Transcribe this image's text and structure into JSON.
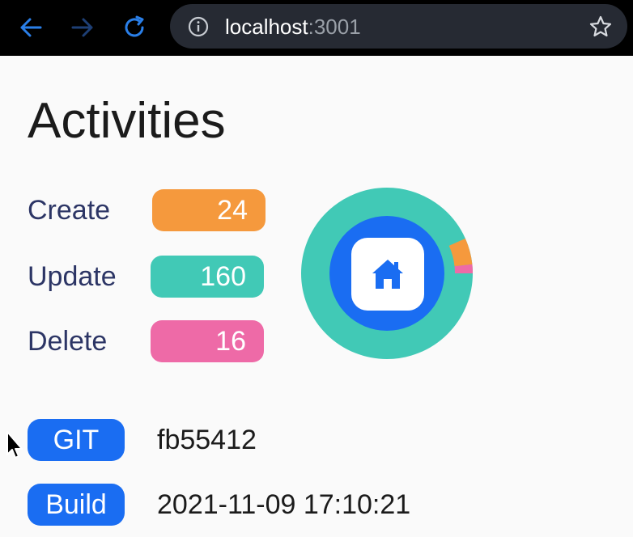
{
  "browser": {
    "url_host": "localhost",
    "url_port": ":3001",
    "icons": {
      "back": "arrow-left-icon",
      "forward": "arrow-right-icon",
      "reload": "reload-icon",
      "info": "info-icon",
      "bookmark": "star-icon"
    },
    "colors": {
      "bar": "#000000",
      "address": "#262a33",
      "back": "#2a7fe8",
      "forward": "#1e3f75",
      "reload": "#2a7fe8"
    }
  },
  "page": {
    "title": "Activities",
    "stats": [
      {
        "label": "Create",
        "value": "24",
        "color": "#f5993d"
      },
      {
        "label": "Update",
        "value": "160",
        "color": "#41c9b6"
      },
      {
        "label": "Delete",
        "value": "16",
        "color": "#ee6aa7"
      }
    ],
    "donut": {
      "icon": "home-icon",
      "center_color": "#1a6df2",
      "values": [
        24,
        160,
        16
      ]
    },
    "info": [
      {
        "label": "GIT",
        "value": "fb55412"
      },
      {
        "label": "Build",
        "value": "2021-11-09 17:10:21"
      }
    ]
  }
}
